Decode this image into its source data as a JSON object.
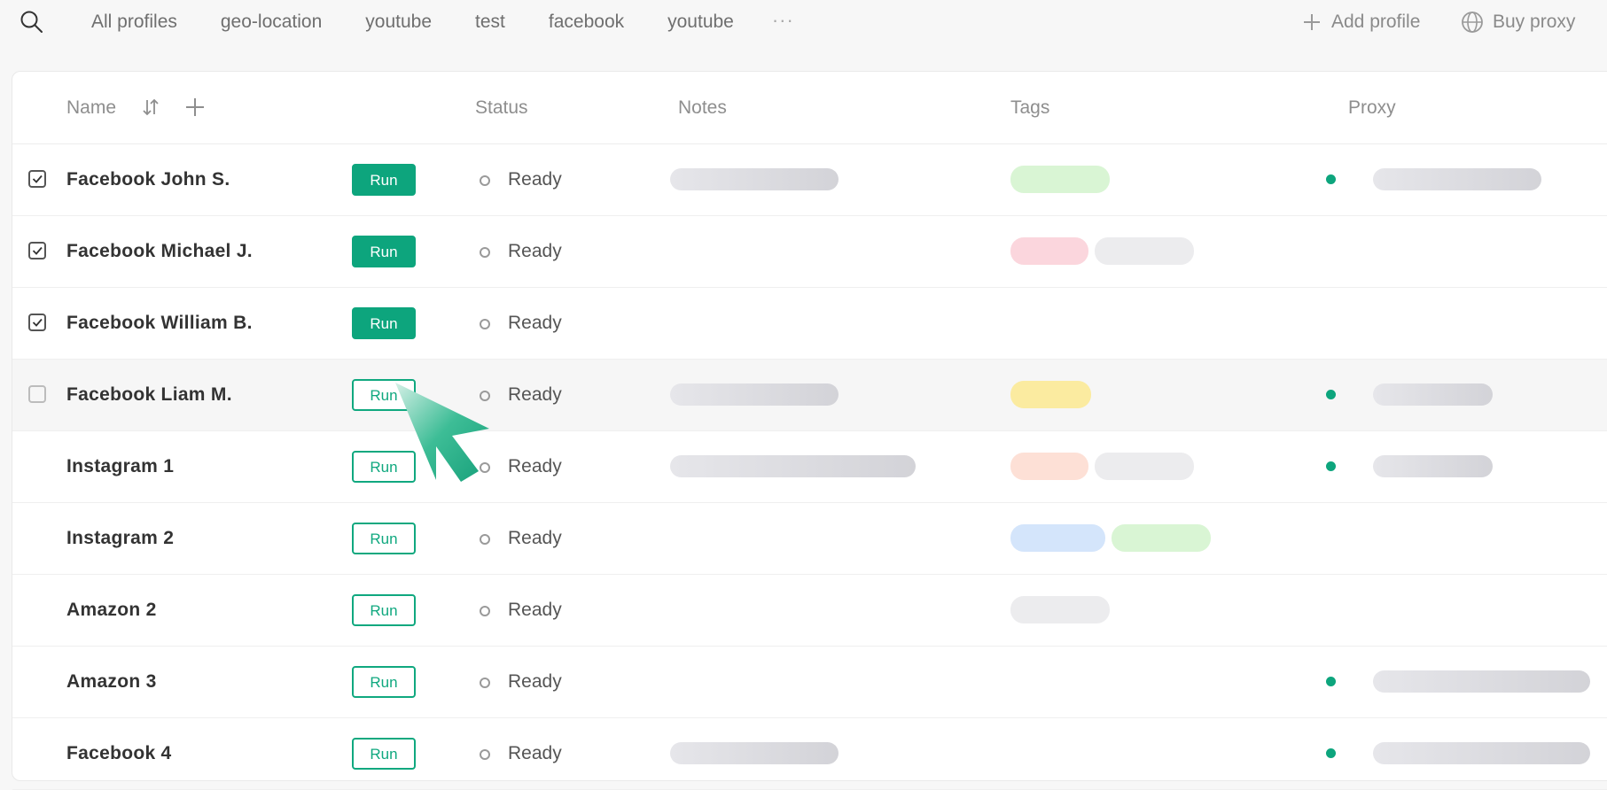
{
  "tabs": [
    {
      "label": "All profiles",
      "active": true
    },
    {
      "label": "geo-location",
      "active": false
    },
    {
      "label": "youtube",
      "active": false
    },
    {
      "label": "test",
      "active": false
    },
    {
      "label": "facebook",
      "active": false
    },
    {
      "label": "youtube",
      "active": false
    }
  ],
  "tab_more": "···",
  "actions": {
    "add_profile": "Add profile",
    "buy_proxy": "Buy proxy"
  },
  "columns": {
    "name": "Name",
    "status": "Status",
    "notes": "Notes",
    "tags": "Tags",
    "proxy": "Proxy"
  },
  "accent_color": "#0da57d",
  "rows": [
    {
      "name": "Facebook John S.",
      "checkbox": "checked",
      "run_label": "Run",
      "run_style": "solid",
      "status": "Ready",
      "notes": "blurred",
      "tags": [
        "#d9f5d4"
      ],
      "proxy": true
    },
    {
      "name": "Facebook Michael J.",
      "checkbox": "checked",
      "run_label": "Run",
      "run_style": "solid",
      "status": "Ready",
      "notes": null,
      "tags": [
        "#fbd6dd",
        "#ececee"
      ],
      "proxy": false
    },
    {
      "name": "Facebook William B.",
      "checkbox": "checked",
      "run_label": "Run",
      "run_style": "solid",
      "status": "Ready",
      "notes": null,
      "tags": [],
      "proxy": false
    },
    {
      "name": "Facebook Liam M.",
      "checkbox": "unchecked",
      "run_label": "Run",
      "run_style": "outline",
      "status": "Ready",
      "notes": "blurred",
      "tags": [
        "#fbeba0"
      ],
      "proxy": true,
      "hover": true
    },
    {
      "name": "Instagram 1",
      "checkbox": "none",
      "run_label": "Run",
      "run_style": "outline",
      "status": "Ready",
      "notes": "blurred-long",
      "tags": [
        "#fde0d6",
        "#ececee"
      ],
      "proxy": true
    },
    {
      "name": "Instagram 2",
      "checkbox": "none",
      "run_label": "Run",
      "run_style": "outline",
      "status": "Ready",
      "notes": null,
      "tags": [
        "#d4e5fb",
        "#d9f5d4"
      ],
      "proxy": false
    },
    {
      "name": "Amazon 2",
      "checkbox": "none",
      "run_label": "Run",
      "run_style": "outline",
      "status": "Ready",
      "notes": null,
      "tags": [
        "#ececee"
      ],
      "proxy": false
    },
    {
      "name": "Amazon 3",
      "checkbox": "none",
      "run_label": "Run",
      "run_style": "outline",
      "status": "Ready",
      "notes": null,
      "tags": [],
      "proxy": true
    },
    {
      "name": "Facebook 4",
      "checkbox": "none",
      "run_label": "Run",
      "run_style": "outline",
      "status": "Ready",
      "notes": "blurred",
      "tags": [],
      "proxy": true
    }
  ]
}
